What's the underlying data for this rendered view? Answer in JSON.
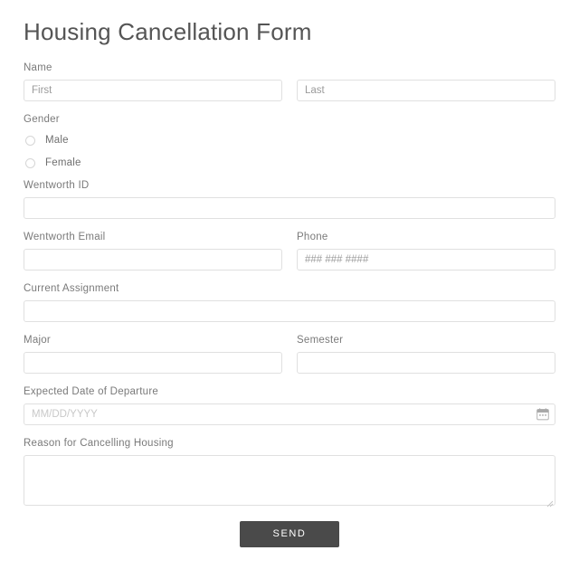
{
  "form": {
    "title": "Housing Cancellation Form",
    "name": {
      "label": "Name",
      "first_placeholder": "First",
      "last_placeholder": "Last",
      "first_value": "",
      "last_value": ""
    },
    "gender": {
      "label": "Gender",
      "options": [
        {
          "label": "Male",
          "selected": false
        },
        {
          "label": "Female",
          "selected": false
        }
      ]
    },
    "wentworth_id": {
      "label": "Wentworth ID",
      "placeholder": "",
      "value": ""
    },
    "wentworth_email": {
      "label": "Wentworth Email",
      "placeholder": "",
      "value": ""
    },
    "phone": {
      "label": "Phone",
      "placeholder": "### ### ####",
      "value": ""
    },
    "current_assignment": {
      "label": "Current Assignment",
      "placeholder": "",
      "value": ""
    },
    "major": {
      "label": "Major",
      "placeholder": "",
      "value": ""
    },
    "semester": {
      "label": "Semester",
      "placeholder": "",
      "value": ""
    },
    "departure_date": {
      "label": "Expected Date of Departure",
      "placeholder": "MM/DD/YYYY",
      "value": "",
      "icon": "calendar-icon"
    },
    "reason": {
      "label": "Reason for Cancelling Housing",
      "placeholder": "",
      "value": ""
    },
    "submit": {
      "label": "SEND"
    }
  },
  "colors": {
    "title_text": "#555555",
    "label_text": "#7a7a7a",
    "input_border": "#e0e0e0",
    "placeholder": "#9b9b9b",
    "date_placeholder": "#c9c9c9",
    "button_bg": "#4a4a4a",
    "button_text": "#ffffff",
    "page_bg": "#ffffff"
  }
}
